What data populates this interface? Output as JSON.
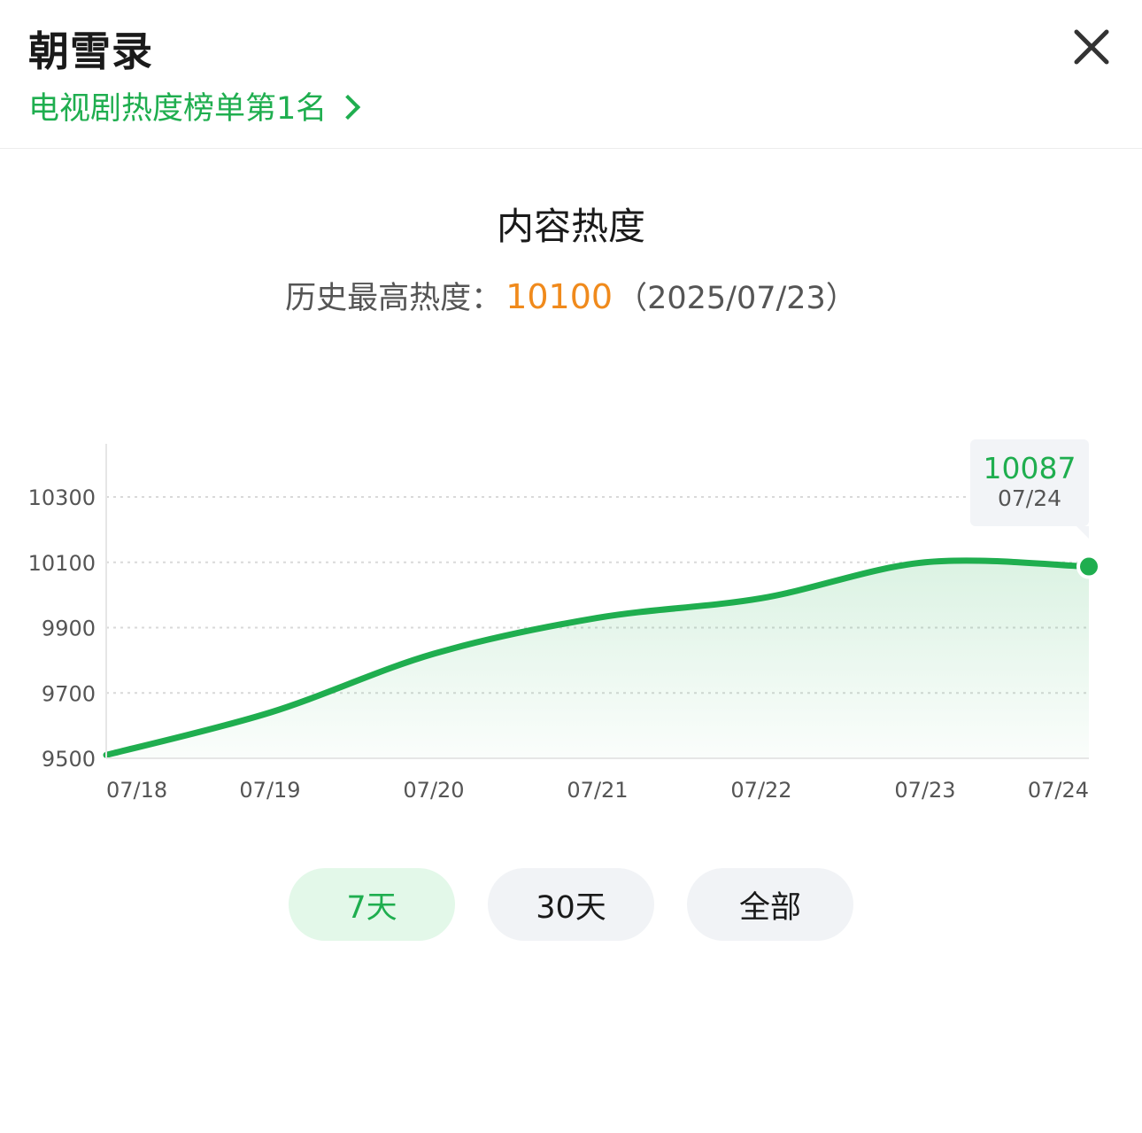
{
  "header": {
    "title": "朝雪录",
    "rank_link": "电视剧热度榜单第1名"
  },
  "section": {
    "title": "内容热度",
    "record_label": "历史最高热度：",
    "record_value": "10100",
    "record_date": "（2025/07/23）"
  },
  "tooltip": {
    "value": "10087",
    "date": "07/24"
  },
  "range_tabs": [
    "7天",
    "30天",
    "全部"
  ],
  "colors": {
    "accent": "#1fae4f",
    "highlight": "#f08a1c",
    "tab_active_bg": "#e3f8e9",
    "tab_bg": "#f1f3f6"
  },
  "chart_data": {
    "type": "area",
    "x": [
      "07/18",
      "07/19",
      "07/20",
      "07/21",
      "07/22",
      "07/23",
      "07/24"
    ],
    "series": [
      {
        "values": [
          9510,
          9640,
          9820,
          9930,
          9990,
          10100,
          10087
        ]
      }
    ],
    "yticks": [
      9500,
      9700,
      9900,
      10100,
      10300
    ],
    "ylim": [
      9500,
      10300
    ],
    "grid": true,
    "line_color": "#1fae4f"
  }
}
